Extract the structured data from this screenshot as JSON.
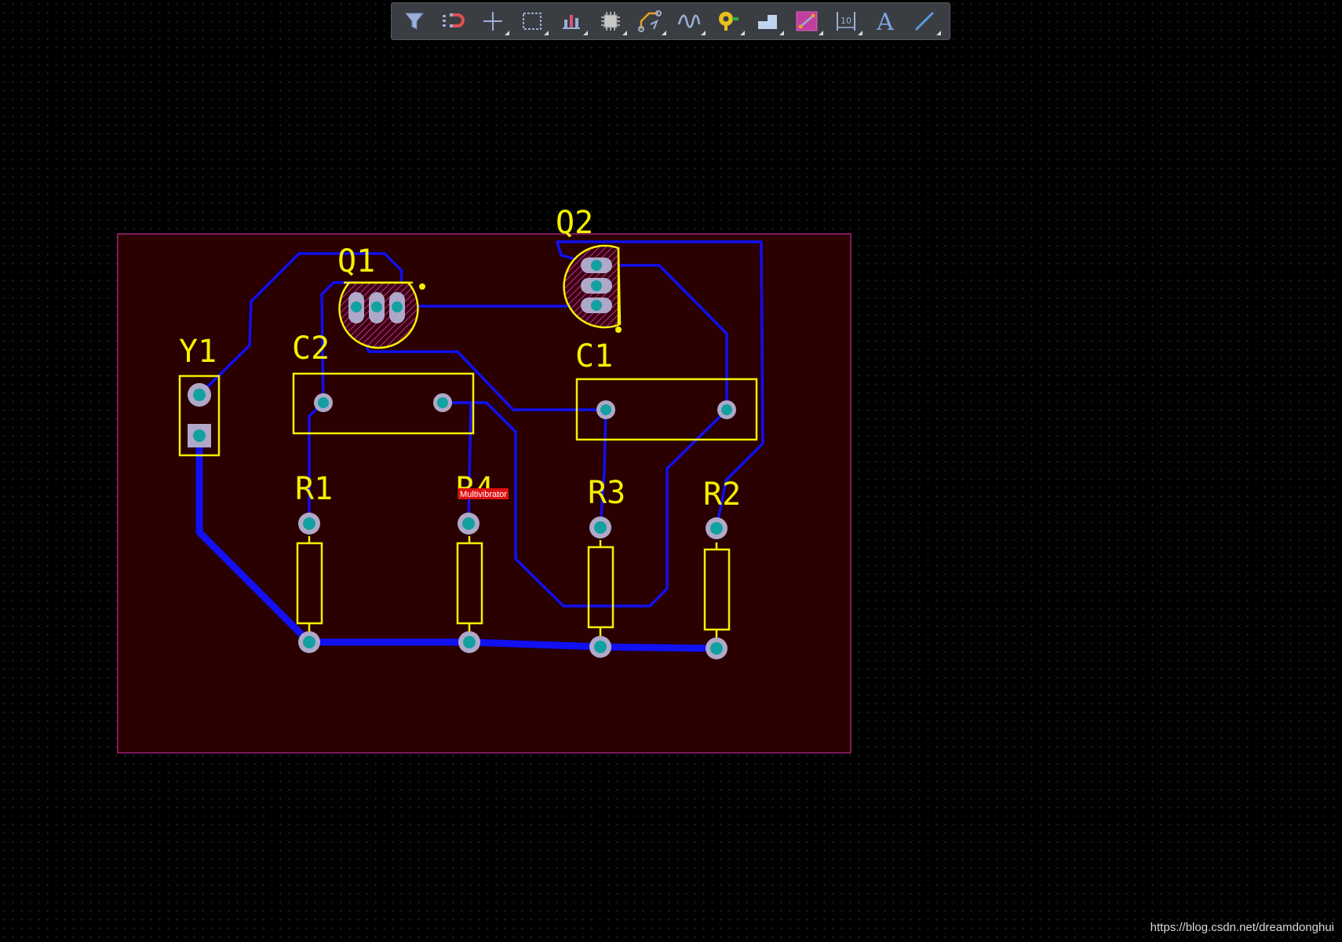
{
  "toolbar": {
    "tools": [
      {
        "icon": "filter-icon",
        "has_submenu": false
      },
      {
        "icon": "snap-magnet-icon",
        "has_submenu": false
      },
      {
        "icon": "crosshair-move-icon",
        "has_submenu": true
      },
      {
        "icon": "select-rectangle-icon",
        "has_submenu": true
      },
      {
        "icon": "align-bars-icon",
        "has_submenu": true
      },
      {
        "icon": "component-chip-icon",
        "has_submenu": true
      },
      {
        "icon": "interactive-route-icon",
        "has_submenu": true
      },
      {
        "icon": "length-tune-icon",
        "has_submenu": true
      },
      {
        "icon": "via-pad-icon",
        "has_submenu": true
      },
      {
        "icon": "polygon-pour-icon",
        "has_submenu": true
      },
      {
        "icon": "diff-pair-icon",
        "has_submenu": true
      },
      {
        "icon": "dimension-icon",
        "has_submenu": true
      },
      {
        "icon": "text-string-icon",
        "has_submenu": false
      },
      {
        "icon": "line-icon",
        "has_submenu": true
      }
    ]
  },
  "board": {
    "designators": {
      "Q1": "Q1",
      "Q2": "Q2",
      "Y1": "Y1",
      "C1": "C1",
      "C2": "C2",
      "R1": "R1",
      "R2": "R2",
      "R3": "R3",
      "R4": "R4"
    },
    "tooltip_label": "Multivibrator"
  },
  "colors": {
    "board_fill": "#2a0000",
    "board_outline": "#a0207a",
    "trace": "#1010f0",
    "silkscreen": "#f5f000",
    "pad_ring": "#b0a8c8",
    "pad_hole": "#12a0a0",
    "tooltip_bg": "#e01010"
  },
  "watermark": "https://blog.csdn.net/dreamdonghui"
}
